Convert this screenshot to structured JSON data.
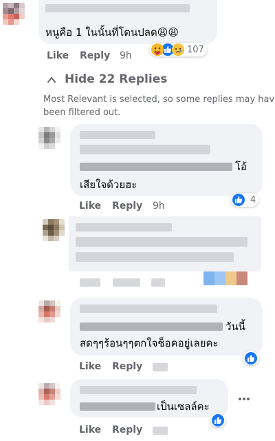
{
  "top_comment": {
    "text": "หนูคือ 1 ในนั้นที่โดนปลด😩😩",
    "like_label": "Like",
    "reply_label": "Reply",
    "time": "9h",
    "reaction_count": "107",
    "reaction_icons": [
      "like-icon",
      "care-icon",
      "sad-icon"
    ]
  },
  "replies_toggle": {
    "label": "Hide 22 Replies",
    "icon": "chevron-up-icon"
  },
  "filter_note": {
    "line1": "Most Relevant is selected, so some replies may have",
    "line2": "been filtered out."
  },
  "replies": [
    {
      "text_line1_tail": "โอ้",
      "text_line2": "เสียใจด้วยฮะ",
      "like_label": "Like",
      "reply_label": "Reply",
      "time": "9h",
      "reaction_count": "4",
      "reaction_icons": [
        "like-icon"
      ]
    },
    {
      "text": "",
      "reaction_icons": [
        "like-icon",
        "haha-icon"
      ]
    },
    {
      "text_line1_tail": "วันนี้",
      "text_line2": "สดๆๆร้อนๆๆตกใจช็อคอยู่เลยคะ",
      "like_label": "Like",
      "reply_label": "Reply",
      "time": "",
      "reaction_icons": [
        "like-icon"
      ]
    },
    {
      "text_line1_tail": "เป็นเซลล์คะ",
      "like_label": "Like",
      "reply_label": "Reply",
      "time": "",
      "reaction_icons": [
        "like-icon"
      ],
      "more_icon": "more-options-icon"
    }
  ],
  "colors": {
    "bubble_bg": "#f0f2f5",
    "meta_text": "#65676b",
    "like_blue": "#1877f2"
  }
}
